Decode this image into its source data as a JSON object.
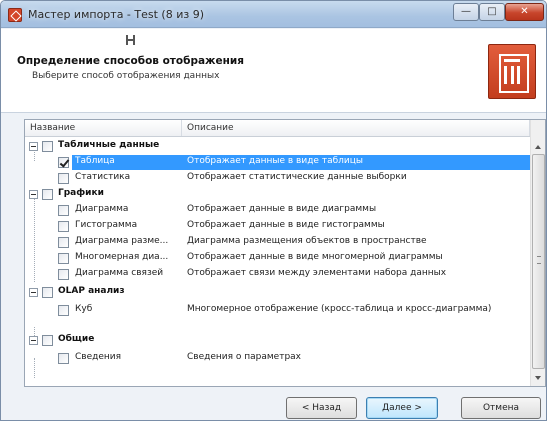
{
  "window": {
    "title": "Мастер импорта - Тest (8 из 9)",
    "controls": {
      "minimize": "—",
      "maximize": "□",
      "close": "✕"
    }
  },
  "header": {
    "title": "Определение способов отображения",
    "subtitle": "Выберите способ отображения данных"
  },
  "table": {
    "columns": {
      "name": "Название",
      "description": "Описание"
    },
    "groups": [
      {
        "label": "Табличные данные",
        "items": [
          {
            "label": "Таблица",
            "description": "Отображает данные в виде таблицы",
            "checked": true,
            "selected": true
          },
          {
            "label": "Статистика",
            "description": "Отображает статистические данные выборки",
            "checked": false,
            "selected": false
          }
        ]
      },
      {
        "label": "Графики",
        "items": [
          {
            "label": "Диаграмма",
            "description": "Отображает данные в виде диаграммы",
            "checked": false,
            "selected": false
          },
          {
            "label": "Гистограмма",
            "description": "Отображает данные в виде гистограммы",
            "checked": false,
            "selected": false
          },
          {
            "label": "Диаграмма разме...",
            "description": "Диаграмма размещения объектов в пространстве",
            "checked": false,
            "selected": false
          },
          {
            "label": "Многомерная диа...",
            "description": "Отображает данные в виде многомерной диаграммы",
            "checked": false,
            "selected": false
          },
          {
            "label": "Диаграмма связей",
            "description": "Отображает связи между элементами набора данных",
            "checked": false,
            "selected": false
          }
        ]
      },
      {
        "label": "OLAP анализ",
        "items": [
          {
            "label": "Куб",
            "description": "Многомерное отображение (кросс-таблица и кросс-диаграмма)",
            "checked": false,
            "selected": false
          }
        ]
      },
      {
        "label": "Общие",
        "items": [
          {
            "label": "Сведения",
            "description": "Сведения о параметрах",
            "checked": false,
            "selected": false
          }
        ]
      }
    ]
  },
  "footer": {
    "back": "< Назад",
    "next": "Далее >",
    "cancel": "Отмена"
  },
  "colors": {
    "selection": "#3399ff",
    "accent_logo": "#c33e1e",
    "window_frame": "#aac4e2"
  },
  "icons": [
    "app-icon",
    "logo-icon",
    "cursor-icon",
    "checkmark-icon",
    "collapse-icon"
  ]
}
